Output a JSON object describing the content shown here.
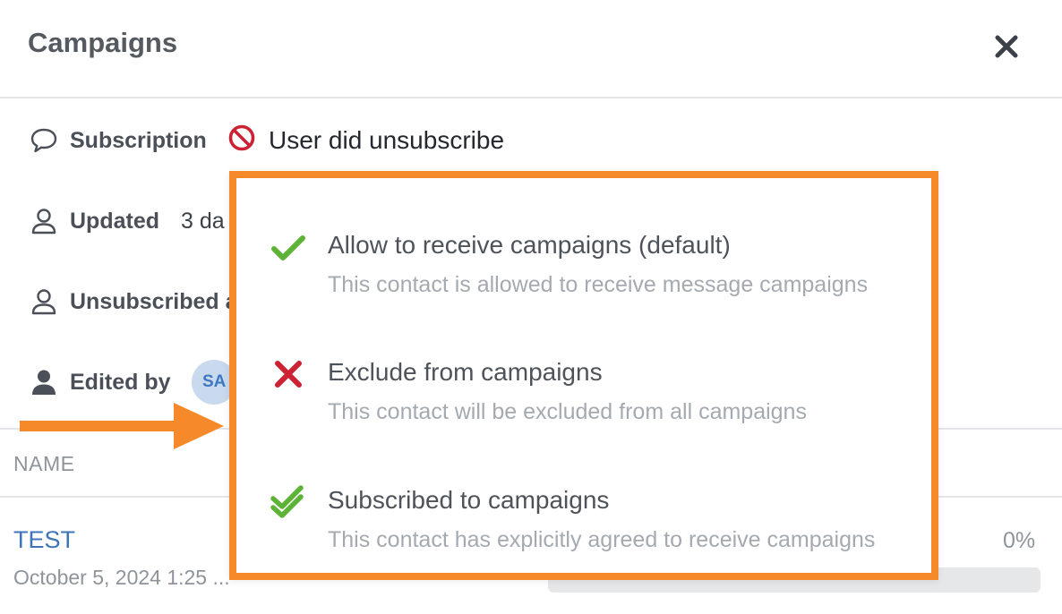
{
  "header": {
    "title": "Campaigns",
    "close_icon": "close-icon"
  },
  "details": {
    "subscription": {
      "label": "Subscription",
      "icon": "chat-bubble-icon",
      "status_icon": "prohibited-icon",
      "status_text": "User did unsubscribe",
      "status_color": "#cc2233"
    },
    "updated": {
      "label": "Updated",
      "icon": "person-outline-icon",
      "value": "3 da"
    },
    "unsubscribed": {
      "label": "Unsubscribed a",
      "icon": "person-outline-icon"
    },
    "edited_by": {
      "label": "Edited by",
      "icon": "person-filled-icon",
      "avatar_initials": "SA"
    }
  },
  "table": {
    "column_name": "NAME",
    "row": {
      "name": "TEST",
      "date": "October 5, 2024 1:25 ...",
      "percent": "0%",
      "progress": 0
    }
  },
  "popup": {
    "border_color": "#f68a2a",
    "options": [
      {
        "icon": "check-icon",
        "title": "Allow to receive campaigns (default)",
        "description": "This contact is allowed to receive message campaigns"
      },
      {
        "icon": "x-mark-icon",
        "title": "Exclude from campaigns",
        "description": "This contact will be excluded from all campaigns"
      },
      {
        "icon": "double-check-icon",
        "title": "Subscribed to campaigns",
        "description": "This contact has explicitly agreed to receive campaigns"
      }
    ]
  },
  "annotation": {
    "arrow_color": "#f68a2a"
  }
}
